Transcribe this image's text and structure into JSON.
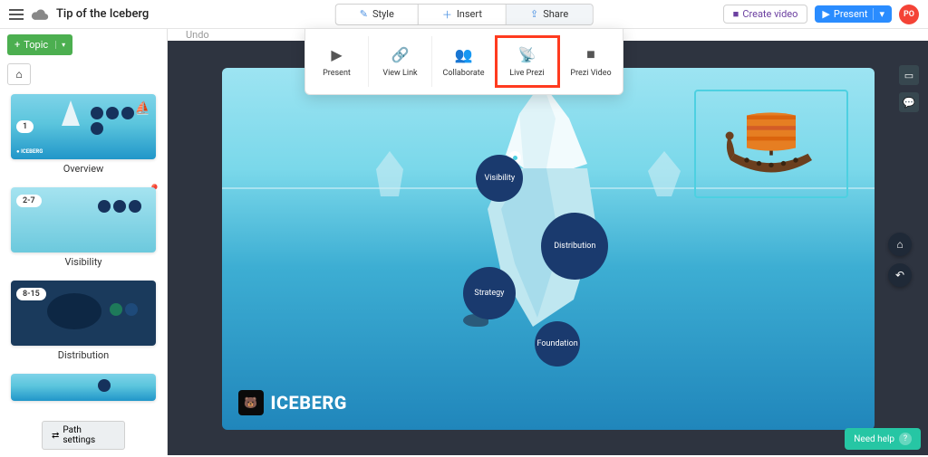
{
  "header": {
    "title": "Tip of the Iceberg",
    "tabs": {
      "style": "Style",
      "insert": "Insert",
      "share": "Share"
    },
    "create_video": "Create video",
    "present": "Present",
    "avatar": "PO"
  },
  "share_menu": {
    "present": "Present",
    "view_link": "View Link",
    "collaborate": "Collaborate",
    "live_prezi": "Live Prezi",
    "prezi_video": "Prezi Video"
  },
  "sidebar": {
    "topic_btn": "Topic",
    "path_settings": "Path settings",
    "thumbs": {
      "overview": {
        "badge": "1",
        "label": "Overview",
        "logo": "ICEBERG"
      },
      "visibility": {
        "badge": "2-7",
        "label": "Visibility"
      },
      "distribution": {
        "badge": "8-15",
        "label": "Distribution"
      }
    }
  },
  "canvas_bar": {
    "undo": "Undo"
  },
  "canvas": {
    "bubbles": {
      "visibility": "Visibility",
      "distribution": "Distribution",
      "strategy": "Strategy",
      "foundation": "Foundation"
    },
    "logo_text": "ICEBERG"
  },
  "help": "Need help"
}
